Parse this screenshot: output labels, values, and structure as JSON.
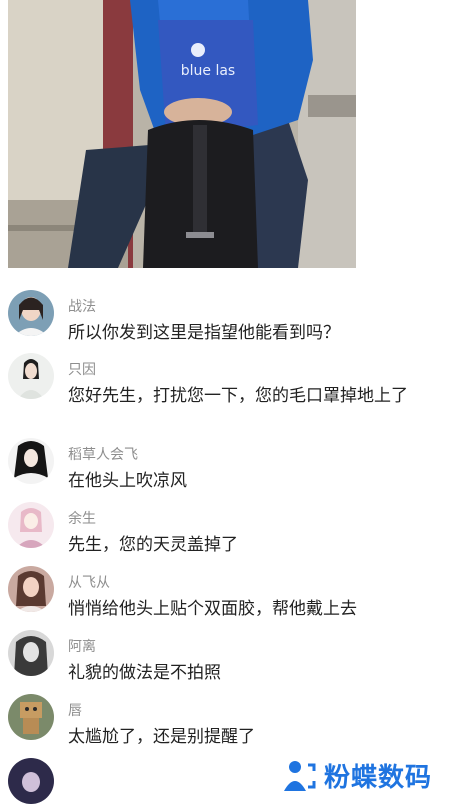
{
  "comments": [
    {
      "user": "战法",
      "text": "所以你发到这里是指望他能看到吗？"
    },
    {
      "user": "只因",
      "text": "您好先生，打扰您一下，您的毛口罩掉地上了"
    },
    {
      "user": "稻草人会飞",
      "text": "在他头上吹凉风"
    },
    {
      "user": "余生",
      "text": "先生，您的天灵盖掉了"
    },
    {
      "user": "从飞从",
      "text": "悄悄给他头上贴个双面胶，帮他戴上去"
    },
    {
      "user": "阿离",
      "text": "礼貌的做法是不拍照"
    },
    {
      "user": "唇",
      "text": "太尴尬了，还是别提醒了"
    }
  ],
  "watermark": {
    "text": "粉蝶数码",
    "color": "#1f74e0"
  },
  "photo": {
    "bag_text": "blue las"
  }
}
